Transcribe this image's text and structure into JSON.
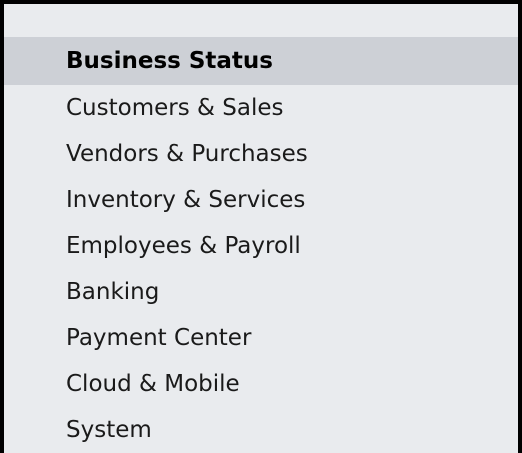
{
  "nav": {
    "items": [
      {
        "label": "Business Status",
        "selected": true
      },
      {
        "label": "Customers & Sales",
        "selected": false
      },
      {
        "label": "Vendors & Purchases",
        "selected": false
      },
      {
        "label": "Inventory & Services",
        "selected": false
      },
      {
        "label": "Employees & Payroll",
        "selected": false
      },
      {
        "label": "Banking",
        "selected": false
      },
      {
        "label": "Payment Center",
        "selected": false
      },
      {
        "label": "Cloud & Mobile",
        "selected": false
      },
      {
        "label": "System",
        "selected": false
      }
    ]
  },
  "colors": {
    "panel_background": "#e9ebee",
    "selected_background": "#cdd0d6",
    "border": "#000000"
  }
}
